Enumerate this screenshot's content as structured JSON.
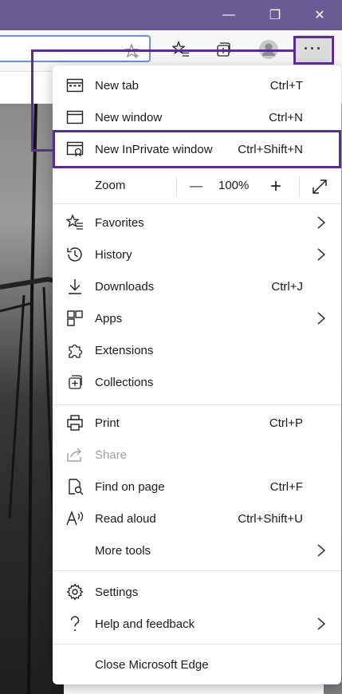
{
  "window": {
    "minimize_glyph": "—",
    "maximize_glyph": "❐",
    "close_glyph": "✕"
  },
  "toolbar": {
    "more_glyph": "···"
  },
  "menu": {
    "new_tab": {
      "label": "New tab",
      "shortcut": "Ctrl+T"
    },
    "new_window": {
      "label": "New window",
      "shortcut": "Ctrl+N"
    },
    "new_inprivate": {
      "label": "New InPrivate window",
      "shortcut": "Ctrl+Shift+N"
    },
    "zoom": {
      "label": "Zoom",
      "minus": "—",
      "value": "100%",
      "plus": "+"
    },
    "favorites": {
      "label": "Favorites"
    },
    "history": {
      "label": "History"
    },
    "downloads": {
      "label": "Downloads",
      "shortcut": "Ctrl+J"
    },
    "apps": {
      "label": "Apps"
    },
    "extensions": {
      "label": "Extensions"
    },
    "collections": {
      "label": "Collections"
    },
    "print": {
      "label": "Print",
      "shortcut": "Ctrl+P"
    },
    "share": {
      "label": "Share"
    },
    "find": {
      "label": "Find on page",
      "shortcut": "Ctrl+F"
    },
    "read_aloud": {
      "label": "Read aloud",
      "shortcut": "Ctrl+Shift+U"
    },
    "more_tools": {
      "label": "More tools"
    },
    "settings": {
      "label": "Settings"
    },
    "help": {
      "label": "Help and feedback"
    },
    "close": {
      "label": "Close Microsoft Edge"
    }
  },
  "colors": {
    "titlebar": "#6b5b95",
    "highlight": "#5b2d90"
  }
}
